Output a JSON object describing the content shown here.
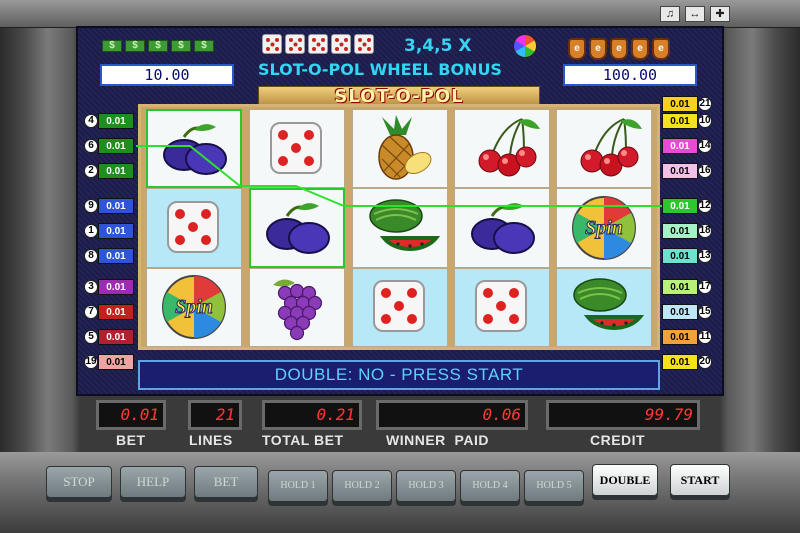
{
  "window_controls": {
    "sound_icon": "speaker-icon",
    "back_icon": "arrows-icon",
    "fullscreen_icon": "expand-icon"
  },
  "header": {
    "left_symbols": "$$$$$",
    "left_amount": "10.00",
    "bonus_multiplier": "3,4,5 X",
    "bonus_title": "SLOT-O-POL WHEEL BONUS",
    "right_symbol": "e",
    "right_amount": "100.00"
  },
  "logo": "SLOT-O-POL",
  "lines_left": [
    {
      "num": "4",
      "val": "0.01",
      "color": "#1e8e1e"
    },
    {
      "num": "6",
      "val": "0.01",
      "color": "#1e8e1e"
    },
    {
      "num": "2",
      "val": "0.01",
      "color": "#1e8e1e"
    },
    {
      "num": "9",
      "val": "0.01",
      "color": "#2f54d8"
    },
    {
      "num": "1",
      "val": "0.01",
      "color": "#2f54d8"
    },
    {
      "num": "8",
      "val": "0.01",
      "color": "#2f54d8"
    },
    {
      "num": "3",
      "val": "0.01",
      "color": "#9b2db3"
    },
    {
      "num": "7",
      "val": "0.01",
      "color": "#c42020"
    },
    {
      "num": "5",
      "val": "0.01",
      "color": "#b02030"
    },
    {
      "num": "19",
      "val": "0.01",
      "color": "#f0a3a3"
    }
  ],
  "lines_right": [
    {
      "num": "21",
      "val": "0.01",
      "color": "#f5d21e"
    },
    {
      "num": "10",
      "val": "0.01",
      "color": "#f5e21e"
    },
    {
      "num": "14",
      "val": "0.01",
      "color": "#e84ad6"
    },
    {
      "num": "16",
      "val": "0.01",
      "color": "#f3c0e8"
    },
    {
      "num": "12",
      "val": "0.01",
      "color": "#2ec62e"
    },
    {
      "num": "18",
      "val": "0.01",
      "color": "#a8f0c8"
    },
    {
      "num": "13",
      "val": "0.01",
      "color": "#6ee0d0"
    },
    {
      "num": "17",
      "val": "0.01",
      "color": "#b9f07a"
    },
    {
      "num": "15",
      "val": "0.01",
      "color": "#bfe6f7"
    },
    {
      "num": "11",
      "val": "0.01",
      "color": "#f2a23b"
    },
    {
      "num": "20",
      "val": "0.01",
      "color": "#f5e21e"
    }
  ],
  "reels": [
    [
      "plum",
      "dice",
      "spin"
    ],
    [
      "dice",
      "plum",
      "grapes"
    ],
    [
      "pineapple",
      "watermelon",
      "dice"
    ],
    [
      "cherries",
      "plum",
      "dice"
    ],
    [
      "cherries",
      "spin",
      "watermelon"
    ]
  ],
  "spin_label": "Spin",
  "message": "DOUBLE: NO - PRESS START",
  "counters": {
    "bet": {
      "value": "0.01",
      "label": "BET"
    },
    "lines": {
      "value": "21",
      "label": "LINES"
    },
    "total_bet": {
      "value": "0.21",
      "label": "TOTAL BET"
    },
    "winner_paid": {
      "value": "0.06",
      "label": "WINNER  PAID"
    },
    "credit": {
      "value": "99.79",
      "label": "CREDIT"
    }
  },
  "buttons": {
    "stop": "STOP",
    "help": "HELP",
    "bet": "BET",
    "hold1": "HOLD 1",
    "hold2": "HOLD 2",
    "hold3": "HOLD 3",
    "hold4": "HOLD 4",
    "hold5": "HOLD 5",
    "double": "DOUBLE",
    "start": "START"
  }
}
